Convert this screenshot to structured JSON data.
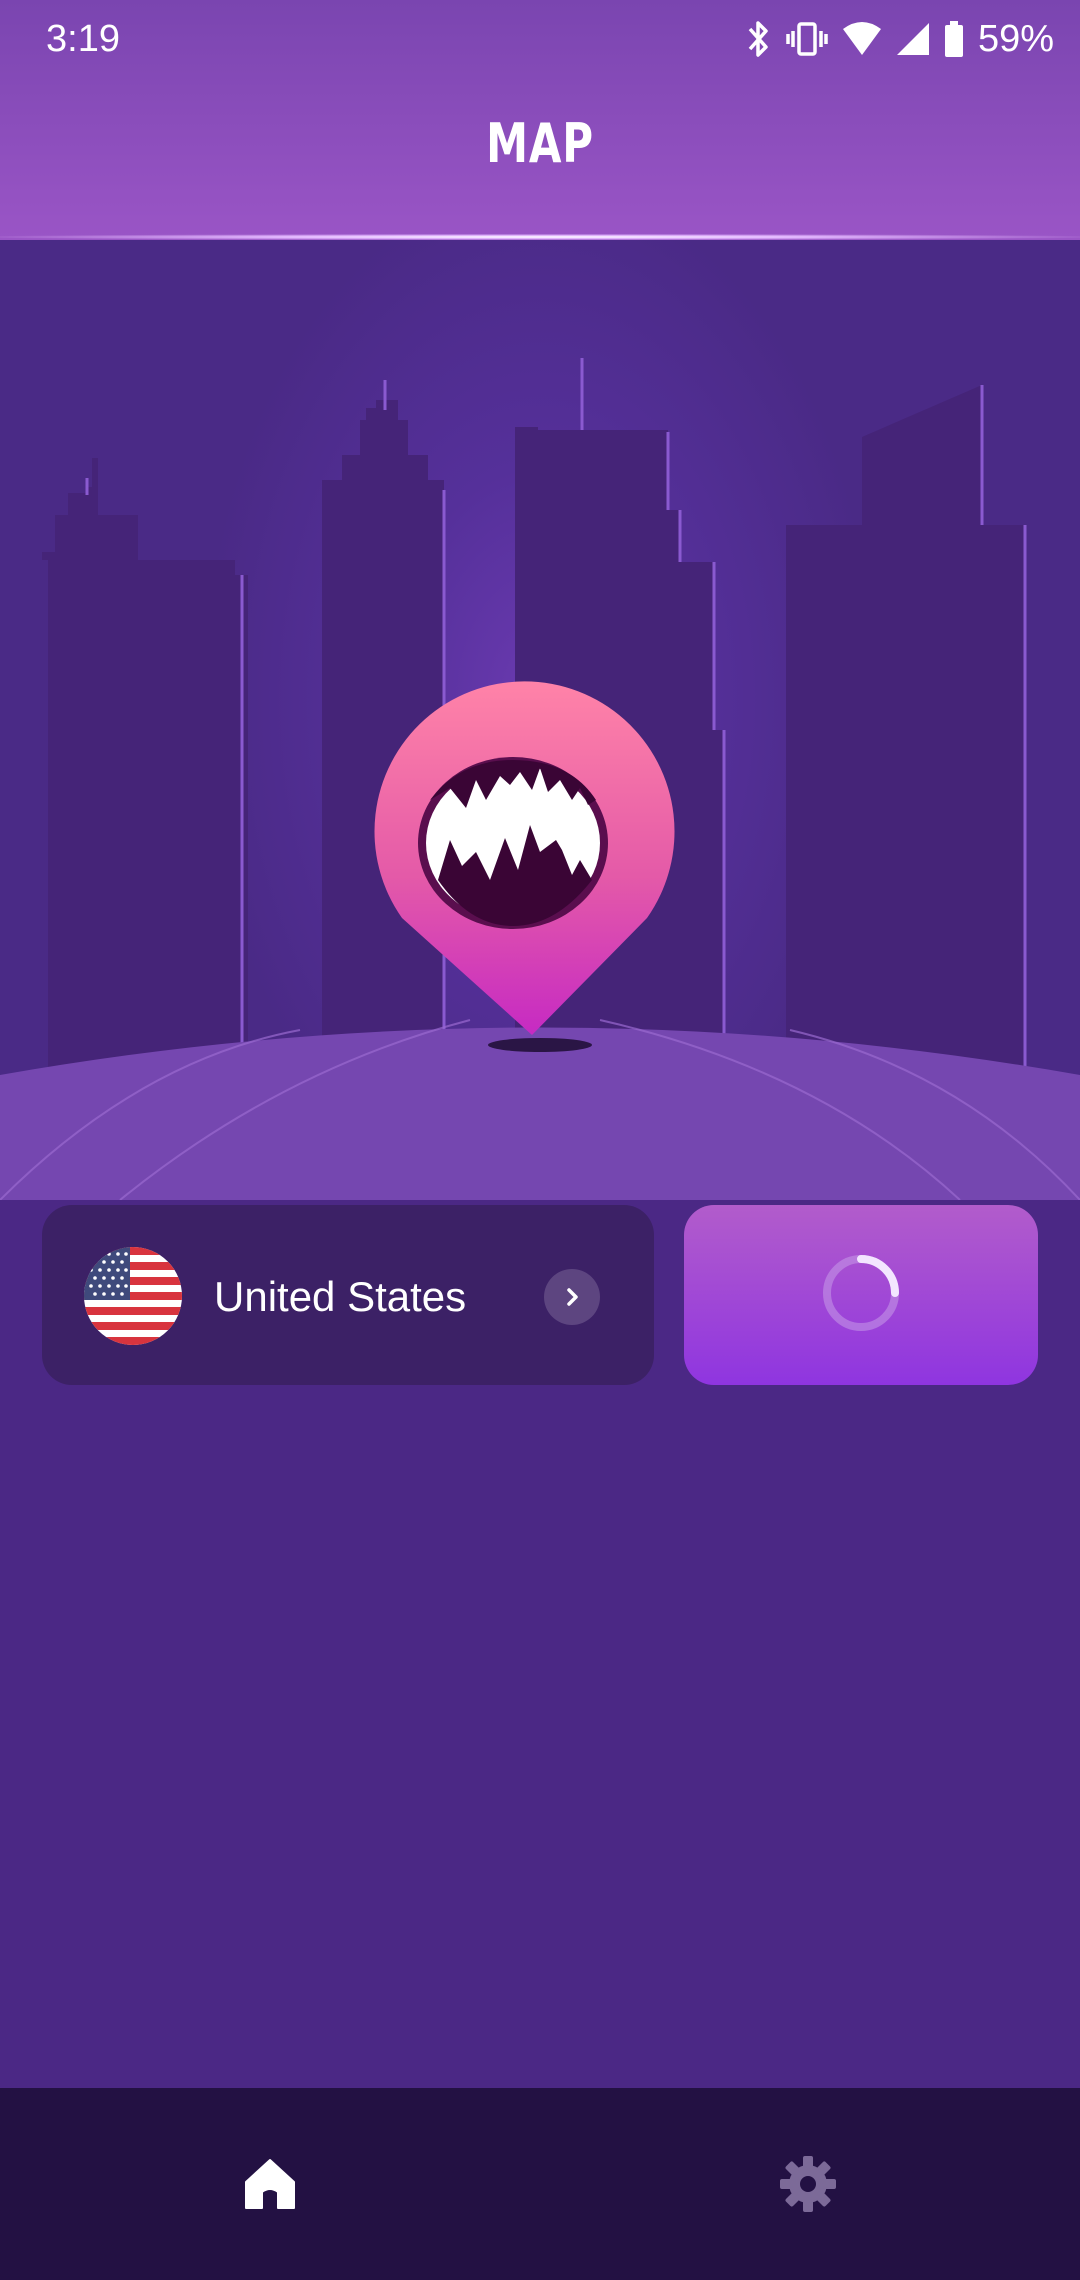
{
  "status_bar": {
    "time": "3:19",
    "battery": "59%",
    "icons": [
      "bluetooth-icon",
      "vibrate-icon",
      "wifi-icon",
      "cell-signal-icon",
      "battery-icon"
    ]
  },
  "header": {
    "title": "MAP"
  },
  "location": {
    "country": "United States",
    "flag": "us-flag-icon"
  },
  "connect": {
    "state_icon": "loading-spinner-icon"
  },
  "bottom_nav": {
    "items": [
      {
        "icon": "home-icon",
        "active": true
      },
      {
        "icon": "gear-icon",
        "active": false
      }
    ]
  },
  "colors": {
    "header": "#8a4dbd",
    "background": "#4b2885",
    "card": "#3c2166",
    "connect_top": "#b25ccb",
    "connect_bottom": "#8f35e0",
    "pin": "#e0489e",
    "nav": "#231143"
  }
}
